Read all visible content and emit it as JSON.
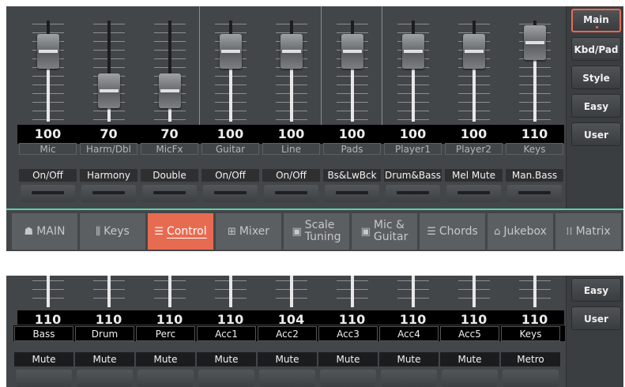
{
  "panel1": {
    "channels": [
      {
        "value": "100",
        "name": "Mic",
        "switch": "On/Off",
        "level": 1.0
      },
      {
        "value": "70",
        "name": "Harm/Dbl",
        "switch": "Harmony",
        "level": 0.55
      },
      {
        "value": "70",
        "name": "MicFx",
        "switch": "Double",
        "level": 0.55
      },
      {
        "value": "100",
        "name": "Guitar",
        "switch": "On/Off",
        "level": 1.0
      },
      {
        "value": "100",
        "name": "Line",
        "switch": "On/Off",
        "level": 1.0
      },
      {
        "value": "100",
        "name": "Pads",
        "switch": "Bs&LwBck",
        "level": 1.0
      },
      {
        "value": "100",
        "name": "Player1",
        "switch": "Drum&Bass",
        "level": 1.0
      },
      {
        "value": "100",
        "name": "Player2",
        "switch": "Mel Mute",
        "level": 1.0
      },
      {
        "value": "110",
        "name": "Keys",
        "switch": "Man.Bass",
        "level": 1.1
      }
    ],
    "side_buttons": [
      "Main",
      "Kbd/Pad",
      "Style",
      "Easy Edit",
      "User"
    ],
    "tabs": [
      {
        "icon": "☗",
        "label": "MAIN",
        "label2": ""
      },
      {
        "icon": "⫼",
        "label": "Keys",
        "label2": ""
      },
      {
        "icon": "☰",
        "label": "Control",
        "label2": ""
      },
      {
        "icon": "⊞",
        "label": "Mixer",
        "label2": ""
      },
      {
        "icon": "▣",
        "label": "Scale",
        "label2": "Tuning"
      },
      {
        "icon": "▣",
        "label": "Mic &",
        "label2": "Guitar"
      },
      {
        "icon": "☰",
        "label": "Chords",
        "label2": ""
      },
      {
        "icon": "⌂",
        "label": "Jukebox",
        "label2": ""
      },
      {
        "icon": "⁞⁞",
        "label": "Matrix",
        "label2": ""
      }
    ]
  },
  "panel2": {
    "channels": [
      {
        "value": "110",
        "name": "Bass",
        "button": "Mute"
      },
      {
        "value": "110",
        "name": "Drum",
        "button": "Mute"
      },
      {
        "value": "110",
        "name": "Perc",
        "button": "Mute"
      },
      {
        "value": "110",
        "name": "Acc1",
        "button": "Mute"
      },
      {
        "value": "104",
        "name": "Acc2",
        "button": "Mute"
      },
      {
        "value": "110",
        "name": "Acc3",
        "button": "Mute"
      },
      {
        "value": "110",
        "name": "Acc4",
        "button": "Mute"
      },
      {
        "value": "110",
        "name": "Acc5",
        "button": "Mute"
      },
      {
        "value": "110",
        "name": "Keys",
        "button": "Metro"
      }
    ],
    "side_buttons": [
      "Easy Edit",
      "User"
    ]
  }
}
